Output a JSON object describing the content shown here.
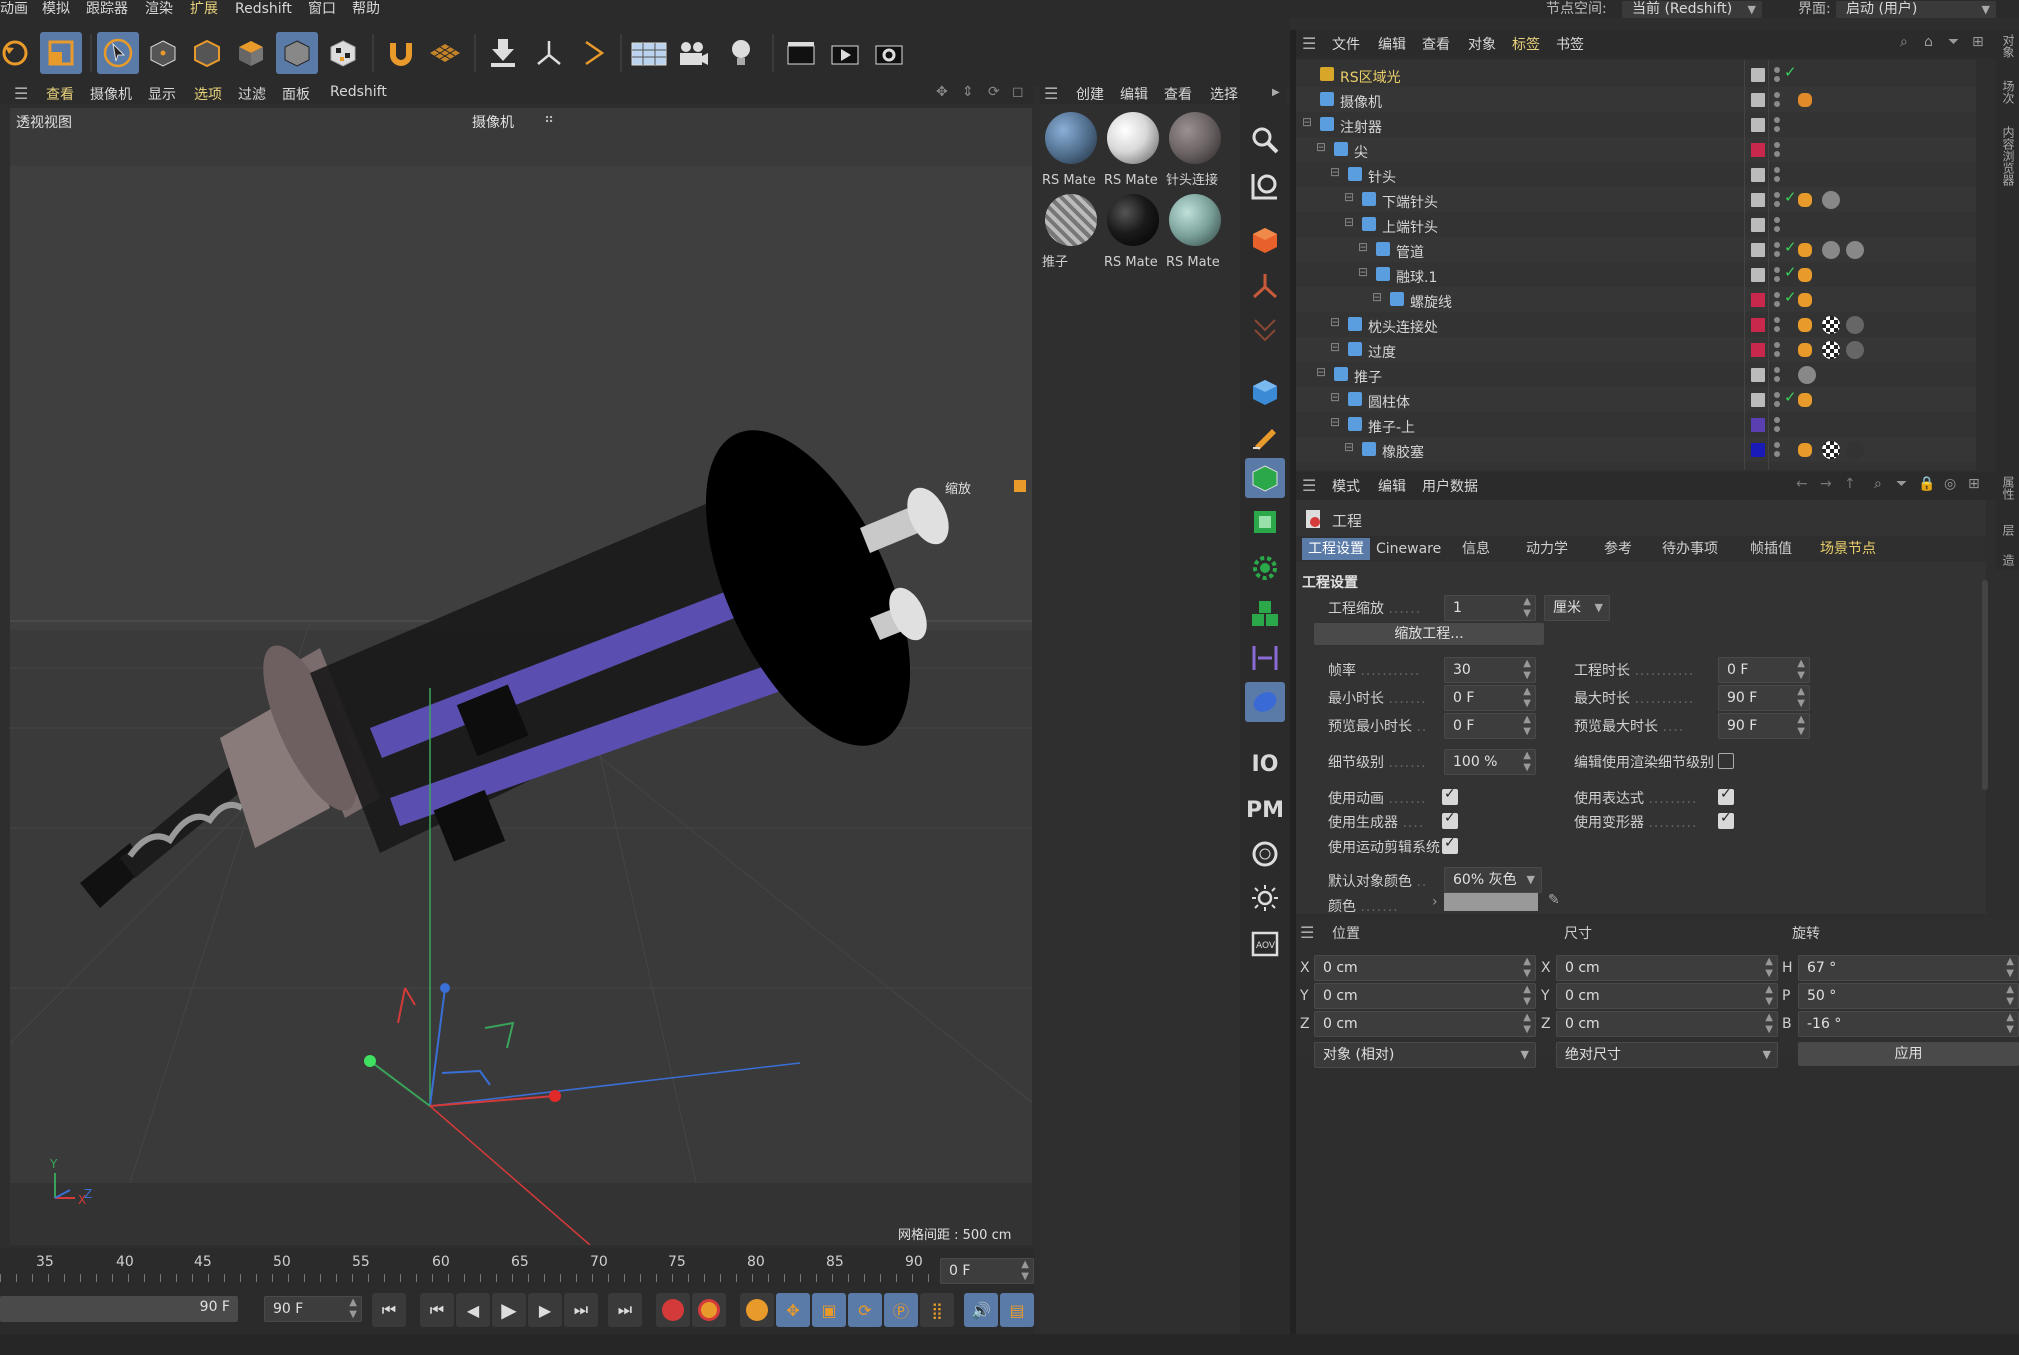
{
  "menubar": {
    "items": [
      "动画",
      "模拟",
      "跟踪器",
      "渲染",
      "扩展",
      "Redshift",
      "窗口",
      "帮助"
    ],
    "node_space_label": "节点空间:",
    "node_space_value": "当前 (Redshift)",
    "layout_label": "界面:",
    "layout_value": "启动 (用户)"
  },
  "viewport": {
    "menu": [
      "查看",
      "摄像机",
      "显示",
      "选项",
      "过滤",
      "面板",
      "Redshift"
    ],
    "menu_selected": [
      "查看",
      "选项"
    ],
    "view_name": "透视视图",
    "camera_label": "摄像机",
    "zoom_label": "缩放",
    "grid_spacing": "网格间距 : 500 cm"
  },
  "timeline": {
    "ticks": [
      "35",
      "40",
      "45",
      "50",
      "55",
      "60",
      "65",
      "70",
      "75",
      "80",
      "85",
      "90"
    ],
    "current_frame": "0 F",
    "end_frame_a": "90 F",
    "end_frame_b": "90 F"
  },
  "materials": {
    "menu": [
      "创建",
      "编辑",
      "查看",
      "选择"
    ],
    "items": [
      {
        "name": "RS Mate",
        "color": "#4d6a88"
      },
      {
        "name": "RS Mate",
        "color": "#d8d8d8"
      },
      {
        "name": "针头连接",
        "color": "#6a6262"
      },
      {
        "name": "推子",
        "color": "#9a9a9a"
      },
      {
        "name": "RS Mate",
        "color": "#1a1a1a"
      },
      {
        "name": "RS Mate",
        "color": "#7aa09a"
      }
    ]
  },
  "tool_column": {
    "text_buttons": [
      "IO",
      "PM"
    ]
  },
  "object_manager": {
    "menu": [
      "文件",
      "编辑",
      "查看",
      "对象",
      "标签",
      "书签"
    ],
    "menu_selected": "标签",
    "rows": [
      {
        "name": "RS区域光",
        "indent": 0,
        "color": "",
        "yellow": true
      },
      {
        "name": "摄像机",
        "indent": 0,
        "color": ""
      },
      {
        "name": "注射器",
        "indent": 0,
        "color": ""
      },
      {
        "name": "尖",
        "indent": 1,
        "color": "#c8284c"
      },
      {
        "name": "针头",
        "indent": 2,
        "color": ""
      },
      {
        "name": "下端针头",
        "indent": 3,
        "color": ""
      },
      {
        "name": "上端针头",
        "indent": 3,
        "color": ""
      },
      {
        "name": "管道",
        "indent": 4,
        "color": ""
      },
      {
        "name": "融球.1",
        "indent": 4,
        "color": ""
      },
      {
        "name": "螺旋线",
        "indent": 5,
        "color": "#c8284c"
      },
      {
        "name": "枕头连接处",
        "indent": 2,
        "color": "#c8284c"
      },
      {
        "name": "过度",
        "indent": 2,
        "color": "#c8284c"
      },
      {
        "name": "推子",
        "indent": 1,
        "color": ""
      },
      {
        "name": "圆柱体",
        "indent": 2,
        "color": ""
      },
      {
        "name": "推子-上",
        "indent": 2,
        "color": "#5a3fb0"
      },
      {
        "name": "橡胶塞",
        "indent": 3,
        "color": "#1a1ab8"
      }
    ]
  },
  "attribute_manager": {
    "menu": [
      "模式",
      "编辑",
      "用户数据"
    ],
    "title": "工程",
    "tabs": [
      "工程设置",
      "Cineware",
      "信息",
      "动力学",
      "参考",
      "待办事项",
      "帧插值",
      "场景节点"
    ],
    "active_tab": "工程设置",
    "section": "工程设置",
    "project_scale_label": "工程缩放",
    "project_scale_value": "1",
    "project_scale_unit": "厘米",
    "scale_button": "缩放工程...",
    "fps_label": "帧率",
    "fps_value": "30",
    "project_time_label": "工程时长",
    "project_time_value": "0 F",
    "min_time_label": "最小时长",
    "min_time_value": "0 F",
    "max_time_label": "最大时长",
    "max_time_value": "90 F",
    "preview_min_label": "预览最小时长",
    "preview_min_value": "0 F",
    "preview_max_label": "预览最大时长",
    "preview_max_value": "90 F",
    "lod_label": "细节级别",
    "lod_value": "100 %",
    "render_lod_label": "编辑使用渲染细节级别",
    "use_anim_label": "使用动画",
    "use_expr_label": "使用表达式",
    "use_gen_label": "使用生成器",
    "use_deform_label": "使用变形器",
    "use_motion_label": "使用运动剪辑系统",
    "default_color_label": "默认对象颜色",
    "default_color_value": "60% 灰色",
    "color_label": "颜色"
  },
  "coordinates": {
    "headers": [
      "位置",
      "尺寸",
      "旋转"
    ],
    "pos": [
      {
        "axis": "X",
        "value": "0 cm"
      },
      {
        "axis": "Y",
        "value": "0 cm"
      },
      {
        "axis": "Z",
        "value": "0 cm"
      }
    ],
    "size": [
      {
        "axis": "X",
        "value": "0 cm"
      },
      {
        "axis": "Y",
        "value": "0 cm"
      },
      {
        "axis": "Z",
        "value": "0 cm"
      }
    ],
    "rot": [
      {
        "axis": "H",
        "value": "67 °"
      },
      {
        "axis": "P",
        "value": "50 °"
      },
      {
        "axis": "B",
        "value": "-16 °"
      }
    ],
    "mode_a": "对象 (相对)",
    "mode_b": "绝对尺寸",
    "apply": "应用"
  },
  "side_tabs": [
    "对象",
    "场次",
    "内容浏览器",
    "属性",
    "层",
    "构造"
  ]
}
